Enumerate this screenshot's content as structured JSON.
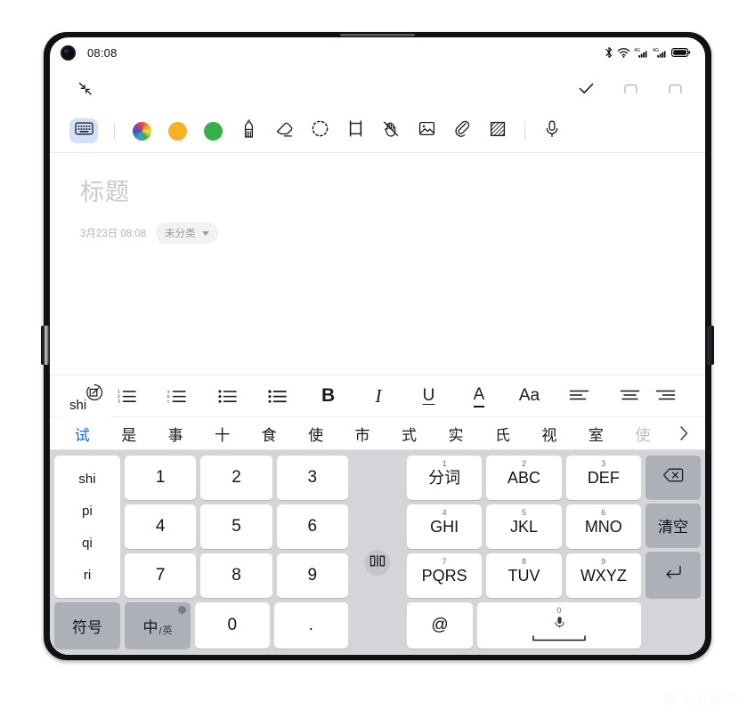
{
  "status_bar": {
    "time": "08:08",
    "icons": [
      "bluetooth-icon",
      "wifi-icon",
      "signal-4g-icon",
      "signal-4g-icon-2",
      "battery-icon"
    ]
  },
  "note_header": {
    "collapse_icon": "collapse-arrows-icon",
    "actions": [
      {
        "name": "confirm-check-icon",
        "glyph": "check",
        "active": true
      },
      {
        "name": "undo-icon",
        "glyph": "undo",
        "active": false
      },
      {
        "name": "redo-icon",
        "glyph": "redo",
        "active": false
      }
    ]
  },
  "toolbar": {
    "items": [
      {
        "name": "keyboard-tool",
        "icon": "keyboard-icon",
        "selected": true
      },
      {
        "name": "color-wheel-tool",
        "icon": "color-wheel-icon",
        "color": ""
      },
      {
        "name": "color-orange-tool",
        "icon": "color-dot-icon",
        "color": "#f7b122"
      },
      {
        "name": "color-green-tool",
        "icon": "color-dot-icon",
        "color": "#34b04a"
      },
      {
        "name": "pen-tool",
        "icon": "pencil-icon"
      },
      {
        "name": "eraser-tool",
        "icon": "eraser-icon"
      },
      {
        "name": "lasso-select-tool",
        "icon": "lasso-dashed-circle-icon"
      },
      {
        "name": "crop-tool",
        "icon": "crop-frame-icon"
      },
      {
        "name": "palm-reject-tool",
        "icon": "hand-no-touch-icon"
      },
      {
        "name": "insert-image-tool",
        "icon": "image-icon"
      },
      {
        "name": "attachment-tool",
        "icon": "paperclip-icon"
      },
      {
        "name": "shading-tool",
        "icon": "hatched-square-icon"
      },
      {
        "name": "voice-input-tool",
        "icon": "microphone-icon"
      }
    ]
  },
  "note": {
    "title_placeholder": "标题",
    "date": "3月23日 08:08",
    "category": "未分类"
  },
  "format_bar": {
    "items": [
      {
        "name": "numbered-list-button",
        "icon": "numbered-list-icon",
        "label": ""
      },
      {
        "name": "lettered-list-button",
        "icon": "lettered-list-icon",
        "label": ""
      },
      {
        "name": "bullet-list-button",
        "icon": "bullet-list-icon",
        "label": ""
      },
      {
        "name": "checklist-button",
        "icon": "bullet-list-dense-icon",
        "label": ""
      },
      {
        "name": "bold-button",
        "icon": "bold-icon",
        "label": "B"
      },
      {
        "name": "italic-button",
        "icon": "italic-icon",
        "label": "I"
      },
      {
        "name": "underline-button",
        "icon": "underline-icon",
        "label": "U"
      },
      {
        "name": "text-color-button",
        "icon": "text-color-a-icon",
        "label": "A"
      },
      {
        "name": "font-size-button",
        "icon": "font-size-icon",
        "label": "Aa"
      },
      {
        "name": "align-left-button",
        "icon": "align-left-icon",
        "label": ""
      },
      {
        "name": "align-center-button",
        "icon": "align-center-icon",
        "label": ""
      },
      {
        "name": "align-right-button",
        "icon": "align-right-icon",
        "label": ""
      }
    ]
  },
  "compose": {
    "text": "shi",
    "icon": "handwriting-edit-circle-icon"
  },
  "candidates": {
    "items": [
      {
        "text": "试",
        "state": "selected"
      },
      {
        "text": "是",
        "state": "normal"
      },
      {
        "text": "事",
        "state": "normal"
      },
      {
        "text": "十",
        "state": "normal"
      },
      {
        "text": "食",
        "state": "normal"
      },
      {
        "text": "使",
        "state": "normal"
      },
      {
        "text": "市",
        "state": "normal"
      },
      {
        "text": "式",
        "state": "normal"
      },
      {
        "text": "实",
        "state": "normal"
      },
      {
        "text": "氏",
        "state": "normal"
      },
      {
        "text": "视",
        "state": "normal"
      },
      {
        "text": "室",
        "state": "normal"
      },
      {
        "text": "使",
        "state": "dim"
      }
    ],
    "expand_icon": "chevron-right-icon"
  },
  "keyboard": {
    "pinyin_column": [
      "shi",
      "pi",
      "qi",
      "ri"
    ],
    "left_rows": [
      [
        {
          "label": "1"
        },
        {
          "label": "2"
        },
        {
          "label": "3"
        }
      ],
      [
        {
          "label": "4"
        },
        {
          "label": "5"
        },
        {
          "label": "6"
        }
      ],
      [
        {
          "label": "7"
        },
        {
          "label": "8"
        },
        {
          "label": "9"
        }
      ]
    ],
    "left_bottom": [
      {
        "name": "symbols-key",
        "label": "符号",
        "style": "gray"
      },
      {
        "name": "language-toggle-key",
        "label": "中",
        "sub": "英",
        "style": "gray",
        "badge": "globe-icon"
      },
      {
        "name": "zero-key",
        "label": "0",
        "style": "white"
      },
      {
        "name": "period-key",
        "label": ".",
        "style": "white"
      }
    ],
    "right_rows": [
      [
        {
          "sup": "1",
          "label": "分词"
        },
        {
          "sup": "2",
          "label": "ABC"
        },
        {
          "sup": "3",
          "label": "DEF"
        }
      ],
      [
        {
          "sup": "4",
          "label": "GHI"
        },
        {
          "sup": "5",
          "label": "JKL"
        },
        {
          "sup": "6",
          "label": "MNO"
        }
      ],
      [
        {
          "sup": "7",
          "label": "PQRS"
        },
        {
          "sup": "8",
          "label": "TUV"
        },
        {
          "sup": "9",
          "label": "WXYZ"
        }
      ]
    ],
    "right_side": [
      {
        "name": "backspace-key",
        "icon": "backspace-icon",
        "label": ""
      },
      {
        "name": "clear-key",
        "icon": "",
        "label": "清空"
      },
      {
        "name": "enter-key",
        "icon": "enter-arrow-icon",
        "label": ""
      }
    ],
    "right_bottom": [
      {
        "name": "at-key",
        "label": "@"
      },
      {
        "name": "space-key",
        "sup": "0",
        "icon": "microphone-icon"
      }
    ],
    "split_button": {
      "name": "split-keyboard-button",
      "icon": "split-merge-icon"
    }
  },
  "watermark": {
    "text": "鹤飞手游网"
  }
}
